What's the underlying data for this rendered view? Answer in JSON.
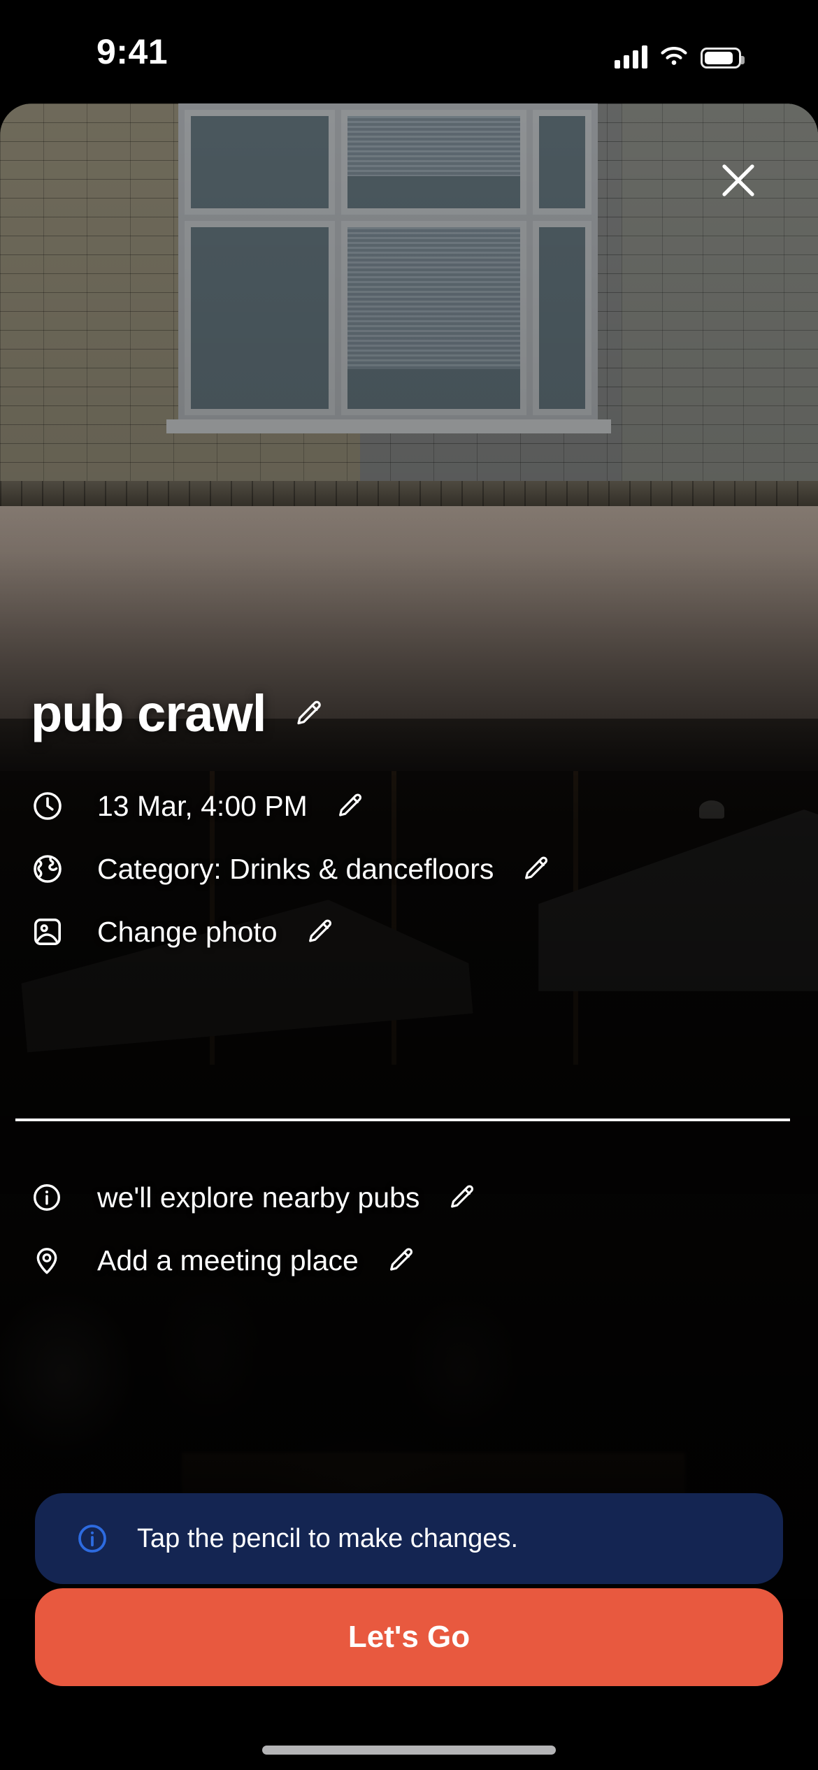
{
  "status_bar": {
    "time": "9:41",
    "icons": [
      "cellular-signal-icon",
      "wifi-icon",
      "battery-icon"
    ]
  },
  "header": {
    "close_icon": "close-icon"
  },
  "event": {
    "title": "pub crawl",
    "title_edit_icon": "pencil-icon",
    "details": [
      {
        "icon": "clock-icon",
        "label": "13 Mar, 4:00 PM",
        "edit_icon": "pencil-icon"
      },
      {
        "icon": "globe-icon",
        "label": "Category: Drinks & dancefloors",
        "edit_icon": "pencil-icon"
      },
      {
        "icon": "photo-icon",
        "label": "Change photo",
        "edit_icon": "pencil-icon"
      }
    ],
    "extras": [
      {
        "icon": "info-circle-icon",
        "label": "we'll explore nearby pubs",
        "edit_icon": "pencil-icon"
      },
      {
        "icon": "map-pin-icon",
        "label": "Add a meeting place",
        "edit_icon": "pencil-icon"
      }
    ]
  },
  "footer": {
    "hint_icon": "info-circle-icon",
    "hint_text": "Tap the pencil to make changes.",
    "cta_label": "Let's Go"
  },
  "colors": {
    "accent": "#e8593f",
    "banner_bg": "#142552",
    "banner_icon": "#2d6be0",
    "text": "#ffffff",
    "background": "#000000"
  }
}
